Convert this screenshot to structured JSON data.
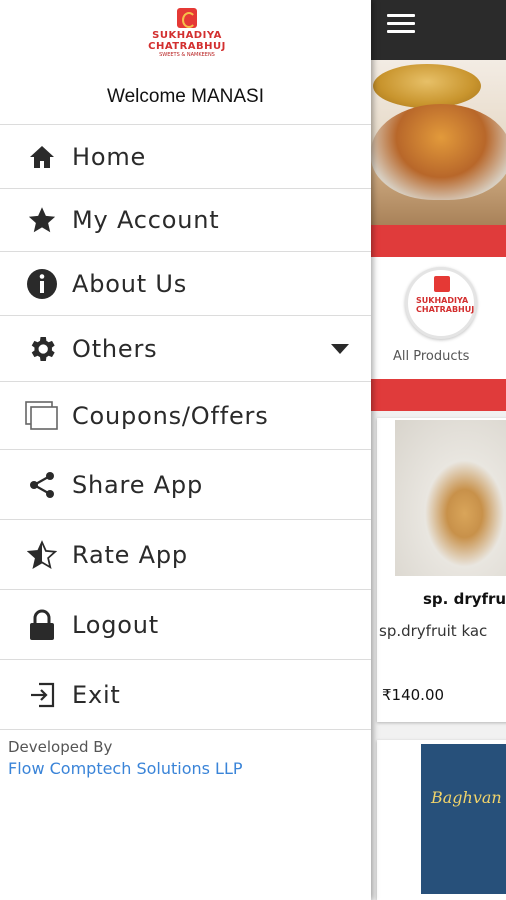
{
  "drawer": {
    "brand": {
      "line1": "SUKHADIYA",
      "line2": "CHATRABHUJ",
      "line3": "SWEETS & NAMKEENS"
    },
    "welcome": "Welcome MANASI",
    "menu": [
      {
        "label": "Home",
        "icon": "home-icon"
      },
      {
        "label": "My Account",
        "icon": "star-icon"
      },
      {
        "label": "About Us",
        "icon": "info-icon"
      },
      {
        "label": "Others",
        "icon": "gear-icon"
      },
      {
        "label": "Coupons/Offers",
        "icon": "coupons-icon"
      },
      {
        "label": "Share App",
        "icon": "share-icon"
      },
      {
        "label": "Rate App",
        "icon": "star-half-icon"
      },
      {
        "label": "Logout",
        "icon": "lock-icon"
      },
      {
        "label": "Exit",
        "icon": "exit-icon"
      }
    ],
    "developed_by_label": "Developed By",
    "developer": "Flow Comptech Solutions LLP"
  },
  "background": {
    "category_logo": {
      "line1": "SUKHADIYA",
      "line2": "CHATRABHUJ"
    },
    "category_label": "All Products",
    "product": {
      "name": "sp. dryfruit",
      "description": "sp.dryfruit kac",
      "price": "₹140.00"
    },
    "product2_title": "Baghvan"
  },
  "colors": {
    "accent_red": "#e03b3b",
    "appbar": "#2b2b2b",
    "link_blue": "#3a84d8"
  }
}
